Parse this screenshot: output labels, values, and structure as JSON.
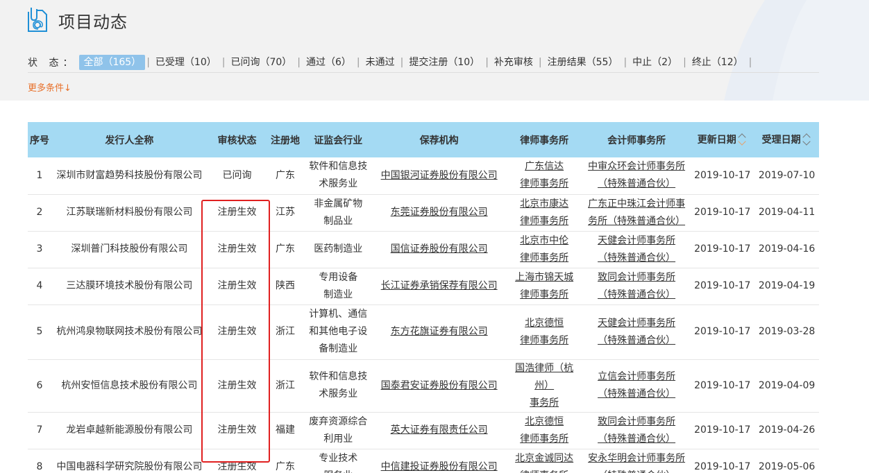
{
  "page_title": "项目动态",
  "filter": {
    "label": "状 态：",
    "items": [
      {
        "label": "全部（165）",
        "active": true
      },
      {
        "label": "已受理（10）",
        "active": false
      },
      {
        "label": "已问询（70）",
        "active": false
      },
      {
        "label": "通过（6）",
        "active": false
      },
      {
        "label": "未通过",
        "active": false
      },
      {
        "label": "提交注册（10）",
        "active": false
      },
      {
        "label": "补充审核",
        "active": false
      },
      {
        "label": "注册结果（55）",
        "active": false
      },
      {
        "label": "中止（2）",
        "active": false
      },
      {
        "label": "终止（12）",
        "active": false
      }
    ],
    "more_label": "更多条件↓"
  },
  "table": {
    "headers": [
      "序号",
      "发行人全称",
      "审核状态",
      "注册地",
      "证监会行业",
      "保荐机构",
      "律师事务所",
      "会计师事务所",
      "更新日期",
      "受理日期"
    ],
    "rows": [
      {
        "no": "1",
        "issuer": "深圳市财富趋势科技股份有限公司",
        "status": "已问询",
        "region": "广东",
        "industry": "软件和信息技术服务业",
        "sponsor": "中国银河证券股份有限公司",
        "law_firm": "广东信达律师事务所",
        "accounting_firm": "中审众环会计师事务所（特殊普通合伙）",
        "update_date": "2019-10-17",
        "accept_date": "2019-07-10"
      },
      {
        "no": "2",
        "issuer": "江苏联瑞新材料股份有限公司",
        "status": "注册生效",
        "region": "江苏",
        "industry": "非金属矿物制品业",
        "sponsor": "东莞证券股份有限公司",
        "law_firm": "北京市康达律师事务所",
        "accounting_firm": "广东正中珠江会计师事务所（特殊普通合伙）",
        "update_date": "2019-10-17",
        "accept_date": "2019-04-11"
      },
      {
        "no": "3",
        "issuer": "深圳普门科技股份有限公司",
        "status": "注册生效",
        "region": "广东",
        "industry": "医药制造业",
        "sponsor": "国信证券股份有限公司",
        "law_firm": "北京市中伦律师事务所",
        "accounting_firm": "天健会计师事务所（特殊普通合伙）",
        "update_date": "2019-10-17",
        "accept_date": "2019-04-16"
      },
      {
        "no": "4",
        "issuer": "三达膜环境技术股份有限公司",
        "status": "注册生效",
        "region": "陕西",
        "industry": "专用设备制造业",
        "sponsor": "长江证券承销保荐有限公司",
        "law_firm": "上海市锦天城律师事务所",
        "accounting_firm": "致同会计师事务所（特殊普通合伙）",
        "update_date": "2019-10-17",
        "accept_date": "2019-04-19"
      },
      {
        "no": "5",
        "issuer": "杭州鸿泉物联网技术股份有限公司",
        "status": "注册生效",
        "region": "浙江",
        "industry": "计算机、通信和其他电子设备制造业",
        "sponsor": "东方花旗证券有限公司",
        "law_firm": "北京德恒律师事务所",
        "accounting_firm": "天健会计师事务所（特殊普通合伙）",
        "update_date": "2019-10-17",
        "accept_date": "2019-03-28"
      },
      {
        "no": "6",
        "issuer": "杭州安恒信息技术股份有限公司",
        "status": "注册生效",
        "region": "浙江",
        "industry": "软件和信息技术服务业",
        "sponsor": "国泰君安证券股份有限公司",
        "law_firm": "国浩律师（杭州）事务所",
        "accounting_firm": "立信会计师事务所（特殊普通合伙）",
        "update_date": "2019-10-17",
        "accept_date": "2019-04-09"
      },
      {
        "no": "7",
        "issuer": "龙岩卓越新能源股份有限公司",
        "status": "注册生效",
        "region": "福建",
        "industry": "废弃资源综合利用业",
        "sponsor": "英大证券有限责任公司",
        "law_firm": "北京德恒律师事务所",
        "accounting_firm": "致同会计师事务所（特殊普通合伙）",
        "update_date": "2019-10-17",
        "accept_date": "2019-04-26"
      },
      {
        "no": "8",
        "issuer": "中国电器科学研究院股份有限公司",
        "status": "注册生效",
        "region": "广东",
        "industry": "专业技术服务业",
        "sponsor": "中信建投证券股份有限公司",
        "law_firm": "北京金诚同达律师事务所",
        "accounting_firm": "安永华明会计师事务所（特殊普通合伙）",
        "update_date": "2019-10-17",
        "accept_date": "2019-05-06"
      }
    ]
  },
  "colors": {
    "accent": "#8fc3ea",
    "table_header": "#a4daf3",
    "more_link": "#e8702a",
    "highlight": "#e02020"
  }
}
